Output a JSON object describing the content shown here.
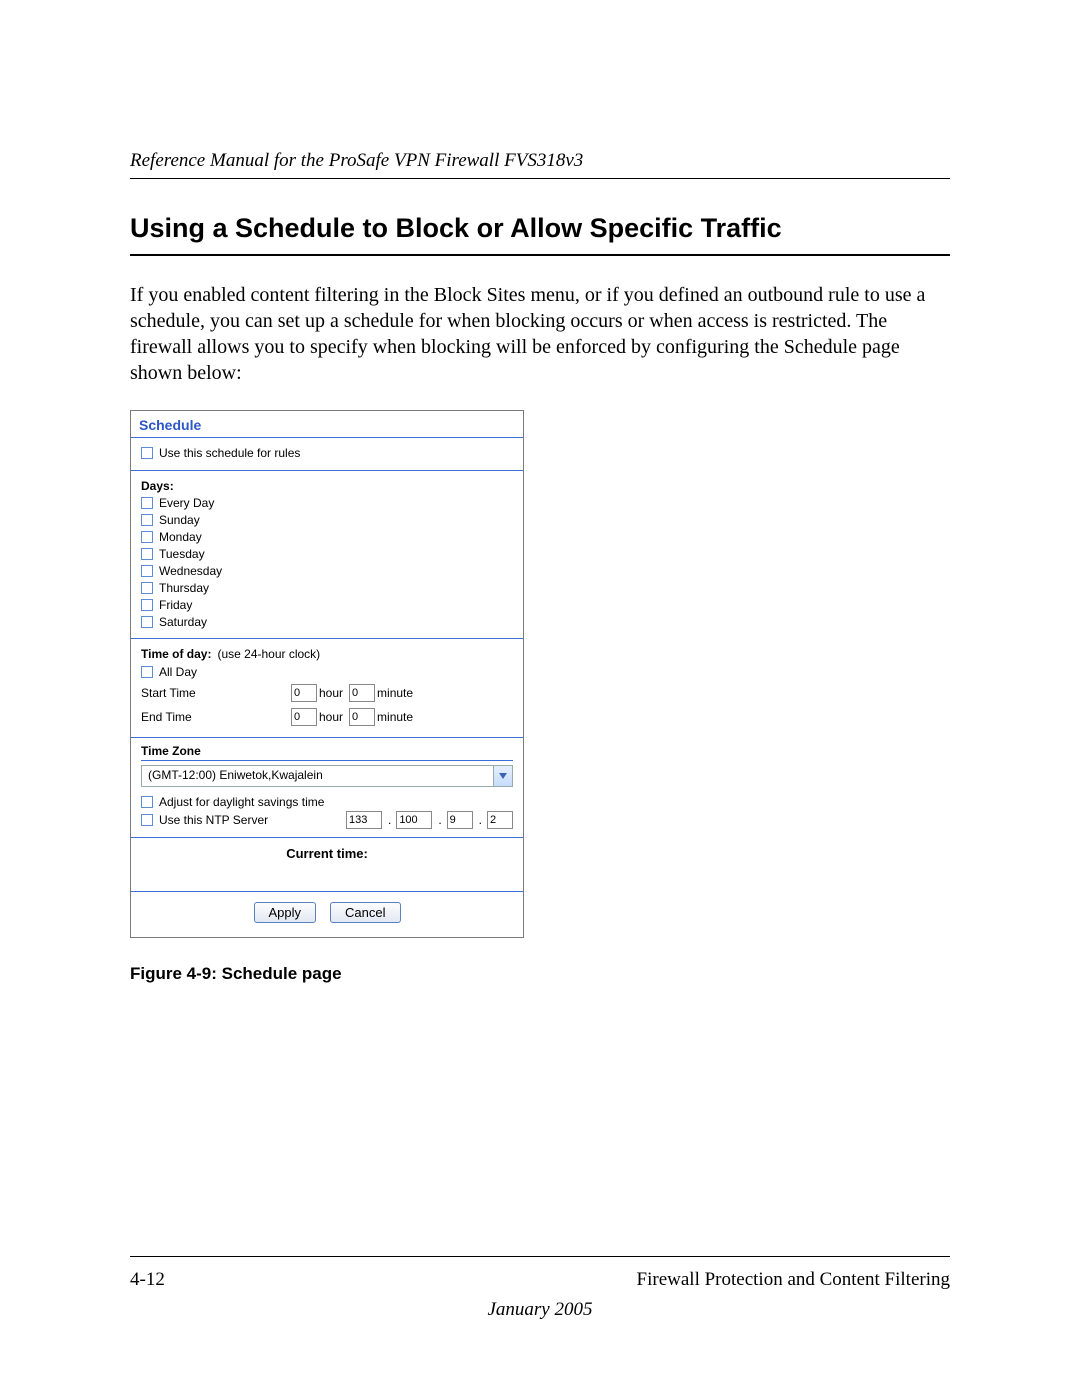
{
  "header": {
    "running": "Reference Manual for the ProSafe VPN Firewall FVS318v3"
  },
  "section": {
    "title": "Using a Schedule to Block or Allow Specific Traffic",
    "body": "If you enabled content filtering in the Block Sites menu, or if you defined an outbound rule to use a schedule, you can set up a schedule for when blocking occurs or when access is restricted. The firewall allows you to specify when blocking will be enforced by configuring the Schedule page shown below:"
  },
  "panel": {
    "title": "Schedule",
    "use_schedule_label": "Use this schedule for rules",
    "days_title": "Days:",
    "days": [
      "Every Day",
      "Sunday",
      "Monday",
      "Tuesday",
      "Wednesday",
      "Thursday",
      "Friday",
      "Saturday"
    ],
    "time_title_bold": "Time of day:",
    "time_title_rest": " (use 24-hour clock)",
    "all_day": "All Day",
    "start_label": "Start Time",
    "end_label": "End Time",
    "start_hour": "0",
    "start_minute": "0",
    "end_hour": "0",
    "end_minute": "0",
    "hour_unit": "hour",
    "minute_unit": "minute",
    "tz_title": "Time Zone",
    "tz_selected": "(GMT-12:00) Eniwetok,Kwajalein",
    "dst_label": "Adjust for daylight savings time",
    "ntp_label": "Use this NTP Server",
    "ntp_ip": [
      "133",
      "100",
      "9",
      "2"
    ],
    "current_time_label": "Current time:",
    "apply": "Apply",
    "cancel": "Cancel"
  },
  "figure_caption": "Figure 4-9:  Schedule page",
  "footer": {
    "page_num": "4-12",
    "chapter": "Firewall Protection and Content Filtering",
    "date": "January 2005"
  }
}
